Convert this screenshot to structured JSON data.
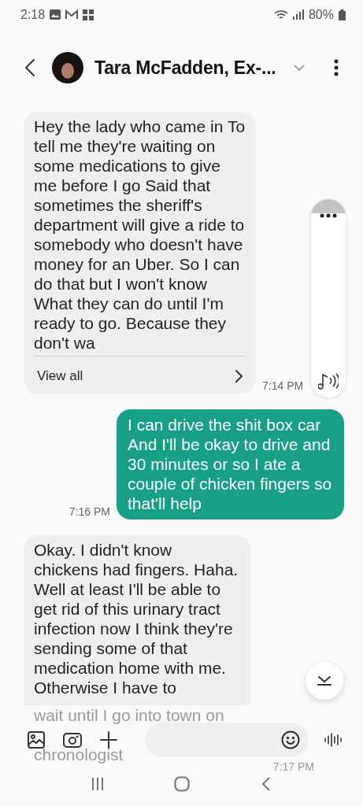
{
  "status_bar": {
    "time": "2:18",
    "battery": "80%"
  },
  "header": {
    "title": "Tara McFadden, Ex-..."
  },
  "messages": [
    {
      "kind": "incoming",
      "text": "Hey the lady who came in To tell me they're waiting on some medications to give me before I go Said that sometimes the sheriff's department will give a ride to somebody who doesn't have money for an Uber. So I can do that but I won't know What they can do until I'm ready to go. Because they don't wa",
      "view_all": "View all",
      "time": "7:14 PM"
    },
    {
      "kind": "outgoing",
      "text": "I can drive the shit box car And I'll be okay to drive and 30 minutes or so I ate a couple of chicken fingers so that'll help",
      "time": "7:16 PM"
    },
    {
      "kind": "incoming",
      "text": "Okay. I didn't know chickens had fingers. Haha. Well at least I'll be able to get rid of this urinary tract infection now I think they're sending some of that medication home with me. Otherwise I have to",
      "faded_lines": [
        "wait until I go into town on",
        "chronologist"
      ],
      "time": "7:17 PM"
    }
  ]
}
